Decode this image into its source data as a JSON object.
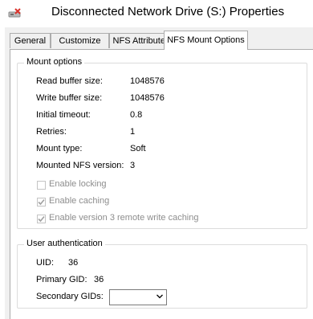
{
  "window": {
    "title": "Disconnected Network Drive (S:) Properties",
    "icon": "disconnected-drive-icon"
  },
  "tabs": [
    {
      "label": "General",
      "active": false
    },
    {
      "label": "Customize",
      "active": false
    },
    {
      "label": "NFS Attributes",
      "active": false
    },
    {
      "label": "NFS Mount Options",
      "active": true
    }
  ],
  "mount_options": {
    "legend": "Mount options",
    "fields": [
      {
        "label": "Read buffer size:",
        "value": "1048576"
      },
      {
        "label": "Write buffer size:",
        "value": "1048576"
      },
      {
        "label": "Initial timeout:",
        "value": "0.8"
      },
      {
        "label": "Retries:",
        "value": "1"
      },
      {
        "label": "Mount type:",
        "value": "Soft"
      },
      {
        "label": "Mounted NFS version:",
        "value": "3"
      }
    ],
    "checkboxes": [
      {
        "label": "Enable locking",
        "checked": false,
        "enabled": false
      },
      {
        "label": "Enable caching",
        "checked": true,
        "enabled": false
      },
      {
        "label": "Enable version 3 remote write caching",
        "checked": true,
        "enabled": false
      }
    ]
  },
  "user_auth": {
    "legend": "User authentication",
    "uid_label": "UID:",
    "uid_value": "36",
    "gid_label": "Primary GID:",
    "gid_value": "36",
    "secondary_label": "Secondary GIDs:",
    "secondary_value": ""
  },
  "colors": {
    "disabled_text": "#8d8d8d",
    "check_mark": "#a0a0a0",
    "icon_red": "#d9322b"
  }
}
